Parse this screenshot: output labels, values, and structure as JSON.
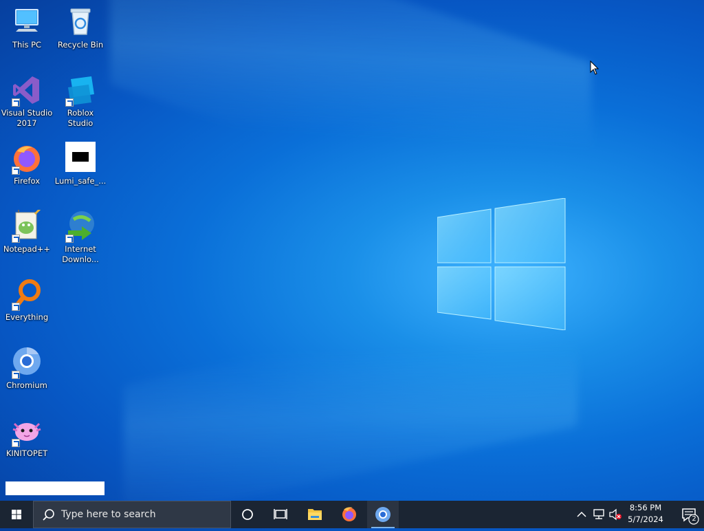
{
  "desktop": {
    "icons": [
      {
        "label": "This PC"
      },
      {
        "label": "Recycle Bin"
      },
      {
        "label": "Visual Studio 2017"
      },
      {
        "label": "Roblox Studio"
      },
      {
        "label": "Firefox"
      },
      {
        "label": "Lumi_safe_..."
      },
      {
        "label": "Notepad++"
      },
      {
        "label": "Internet Downlo..."
      },
      {
        "label": "Everything"
      },
      {
        "label": "Chromium"
      },
      {
        "label": "KINITOPET"
      }
    ]
  },
  "taskbar": {
    "search_placeholder": "Type here to search",
    "pinned": [
      {
        "icon": "cortana-circle-icon"
      },
      {
        "icon": "task-view-icon"
      },
      {
        "icon": "file-explorer-icon"
      },
      {
        "icon": "firefox-icon"
      },
      {
        "icon": "chromium-icon"
      }
    ],
    "clock": {
      "time": "8:56 PM",
      "date": "5/7/2024"
    },
    "notification_count": "2"
  },
  "colors": {
    "taskbar_bg": "#1b2533",
    "search_bg": "#2f3846",
    "desktop_accent": "#0a6fd8"
  }
}
